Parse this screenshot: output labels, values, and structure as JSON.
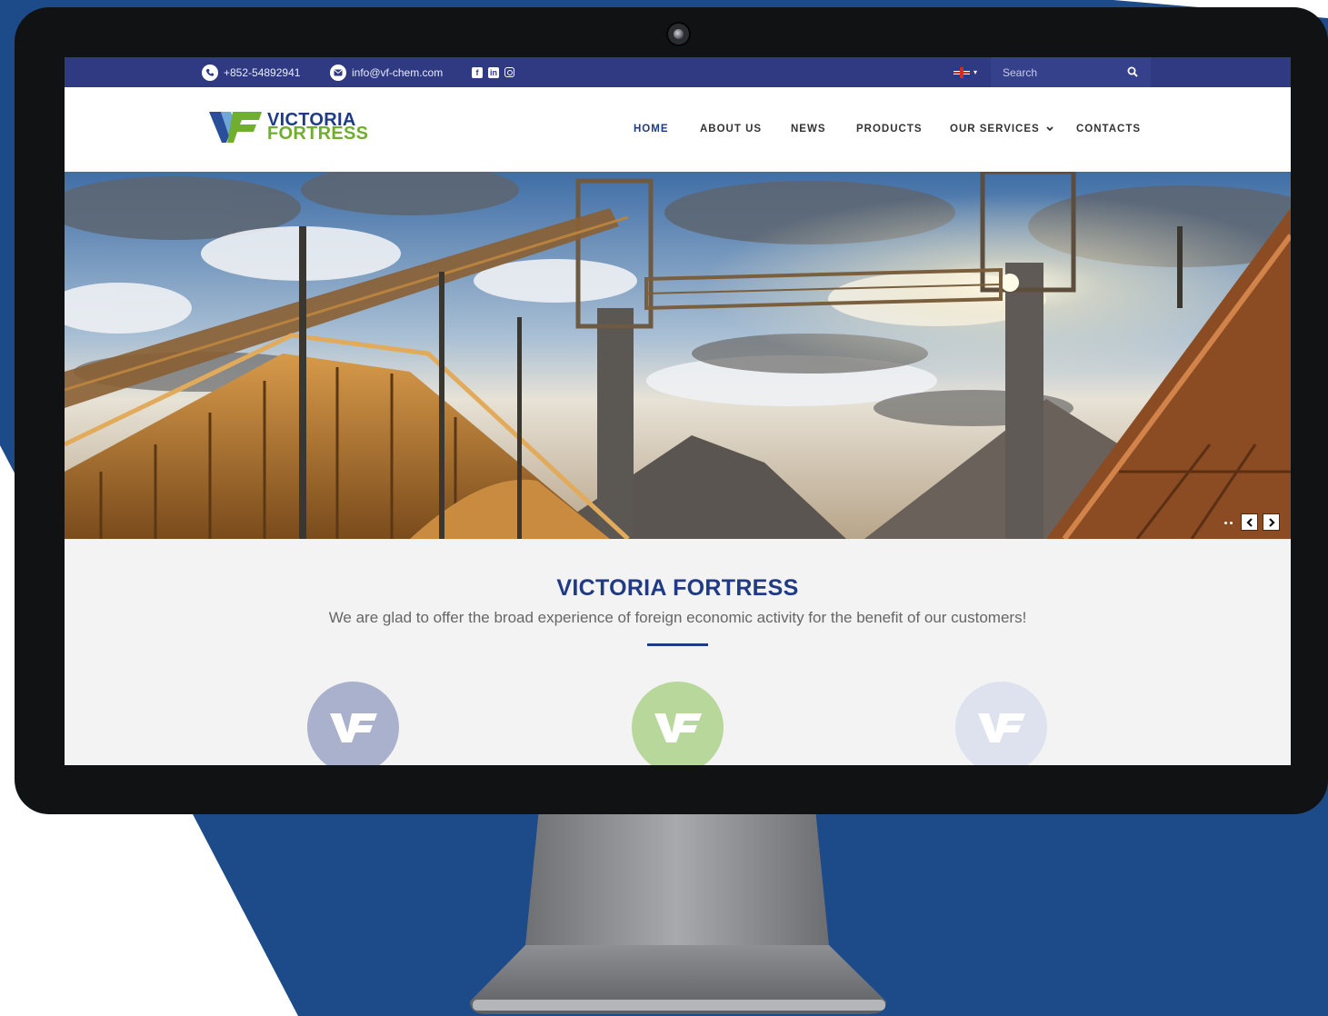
{
  "colors": {
    "brand_blue": "#1f3b86",
    "brand_green": "#6fae2f",
    "topbar_bg": "#2f3a83",
    "background_blue": "#1d4a88"
  },
  "topbar": {
    "phone": "+852-54892941",
    "email": "info@vf-chem.com",
    "social_icons": [
      "facebook-icon",
      "linkedin-icon",
      "instagram-icon"
    ],
    "language_icon": "uk-flag-icon",
    "search_placeholder": "Search"
  },
  "logo": {
    "line1": "VICTORIA",
    "line2": "FORTRESS"
  },
  "nav": {
    "items": [
      {
        "label": "HOME",
        "active": true
      },
      {
        "label": "ABOUT US",
        "active": false
      },
      {
        "label": "NEWS",
        "active": false
      },
      {
        "label": "PRODUCTS",
        "active": false
      },
      {
        "label": "OUR SERVICES",
        "active": false,
        "has_dropdown": true
      },
      {
        "label": "CONTACTS",
        "active": false
      }
    ]
  },
  "hero": {
    "slider_prev_icon": "chevron-left-icon",
    "slider_next_icon": "chevron-right-icon"
  },
  "intro": {
    "title": "VICTORIA FORTRESS",
    "subtitle": "We are glad to offer the broad experience of foreign economic activity for the benefit of our customers!"
  },
  "badges": [
    {
      "icon": "vf-logo-icon",
      "color": "#a9b1cc"
    },
    {
      "icon": "vf-logo-icon",
      "color": "#b7d79b"
    },
    {
      "icon": "vf-logo-icon",
      "color": "#dde2ee"
    }
  ]
}
